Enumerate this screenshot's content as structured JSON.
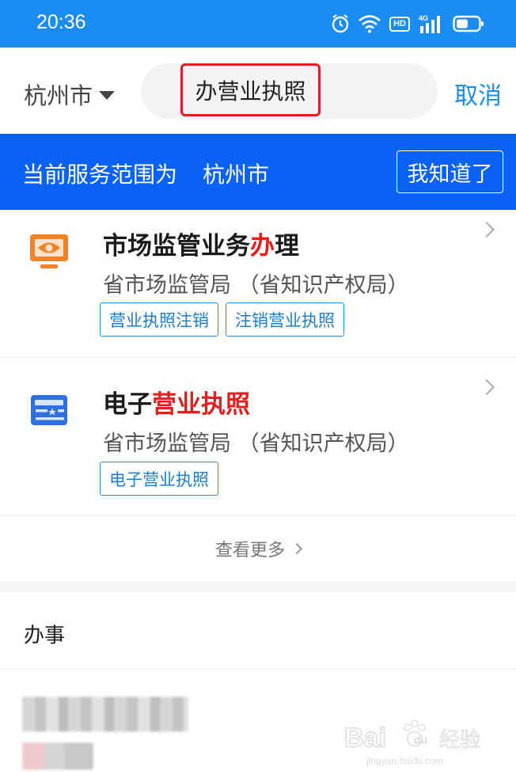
{
  "status_bar": {
    "time": "20:36",
    "icons": [
      "alarm-icon",
      "wifi-icon",
      "hd-badge",
      "cellular-4g-icon",
      "battery-icon"
    ],
    "hd_label": "HD",
    "network_label": "4G"
  },
  "search": {
    "city": "杭州市",
    "query": "办营业执照",
    "cancel_label": "取消"
  },
  "banner": {
    "range_text": "当前服务范围为",
    "range_city": "杭州市",
    "ack_label": "我知道了"
  },
  "results": [
    {
      "icon": "monitor-eye-icon",
      "title_before": "市场监管业务",
      "title_highlight": "办",
      "title_after": "理",
      "dept": "省市场监管局 （省知识产权局）",
      "tags": [
        "营业执照注销",
        "注销营业执照"
      ]
    },
    {
      "icon": "license-card-icon",
      "title_before": "电子",
      "title_highlight": "营业执照",
      "title_after": "",
      "dept": "省市场监管局 （省知识产权局）",
      "tags": [
        "电子营业执照"
      ]
    }
  ],
  "more_label": "查看更多",
  "section": {
    "title": "办事"
  },
  "watermark": {
    "brand": "Bai",
    "brand2": "du",
    "cn": "经验",
    "url": "jingyan.baidu.com"
  },
  "colors": {
    "status_bar": "#1a8cf2",
    "banner": "#0a62f5",
    "accent": "#1a8cf2",
    "highlight": "#e02020",
    "tag_border": "#2a8fd8"
  }
}
